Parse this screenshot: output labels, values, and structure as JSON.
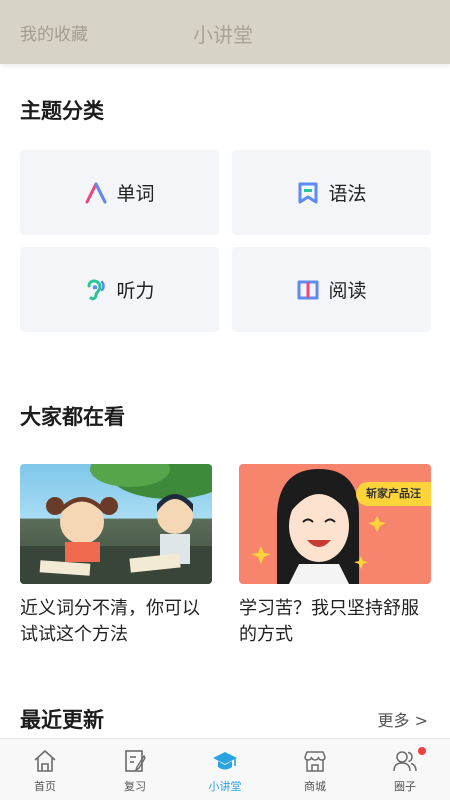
{
  "header": {
    "tab_favorites": "我的收藏",
    "tab_lecture": "小讲堂"
  },
  "topics": {
    "title": "主题分类",
    "items": [
      {
        "label": "单词",
        "icon": "letter-a-icon"
      },
      {
        "label": "语法",
        "icon": "bookmark-icon"
      },
      {
        "label": "听力",
        "icon": "ear-icon"
      },
      {
        "label": "阅读",
        "icon": "open-book-icon"
      }
    ]
  },
  "hot": {
    "title": "大家都在看",
    "articles": [
      {
        "title": "近义词分不清，你可以试试这个方法"
      },
      {
        "title": "学习苦？我只坚持舒服的方式",
        "badge": "斩家产品汪"
      }
    ]
  },
  "recent": {
    "title": "最近更新",
    "more": "更多 >"
  },
  "nav": {
    "items": [
      {
        "label": "首页",
        "icon": "home-icon"
      },
      {
        "label": "复习",
        "icon": "review-icon"
      },
      {
        "label": "小讲堂",
        "icon": "graduation-cap-icon",
        "active": true
      },
      {
        "label": "商城",
        "icon": "store-icon"
      },
      {
        "label": "圈子",
        "icon": "people-icon",
        "notification_dot": true
      }
    ]
  },
  "colors": {
    "header_bg": "#d8d3c7",
    "accent": "#2aa3e0",
    "card_bg": "#f4f5f8",
    "badge_bg": "#ffd43a",
    "notification": "#ef3f3f"
  }
}
